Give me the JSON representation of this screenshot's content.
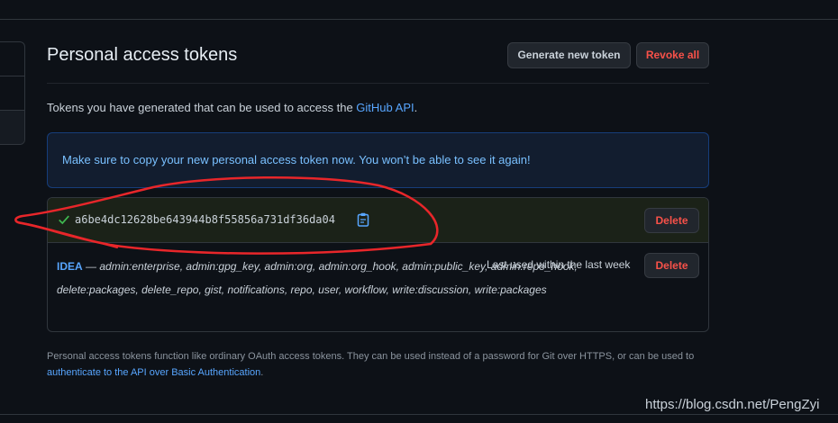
{
  "page": {
    "title": "Personal access tokens",
    "generate_button": "Generate new token",
    "revoke_all_button": "Revoke all"
  },
  "intro": {
    "text": "Tokens you have generated that can be used to access the ",
    "link": "GitHub API",
    "suffix": "."
  },
  "flash": {
    "message": "Make sure to copy your new personal access token now. You won’t be able to see it again!"
  },
  "new_token": {
    "value": "a6be4dc12628be643944b8f55856a731df36da04",
    "delete_label": "Delete",
    "icons": [
      "check-icon",
      "clipboard-icon"
    ]
  },
  "token": {
    "name": "IDEA",
    "separator": " — ",
    "scopes": "admin:enterprise, admin:gpg_key, admin:org, admin:org_hook, admin:public_key, admin:repo_hook, delete:packages, delete_repo, gist, notifications, repo, user, workflow, write:discussion, write:packages",
    "last_used": "Last used within the last week",
    "delete_label": "Delete"
  },
  "footnote": {
    "text": "Personal access tokens function like ordinary OAuth access tokens. They can be used instead of a password for Git over HTTPS, or can be used to ",
    "link": "authenticate to the API over Basic Authentication",
    "suffix": "."
  },
  "watermark": "https://blog.csdn.net/PengZyi",
  "colors": {
    "background": "#0d1117",
    "link": "#58a6ff",
    "danger": "#f85149",
    "success": "#3fb950",
    "annotation": "#e8262a"
  }
}
